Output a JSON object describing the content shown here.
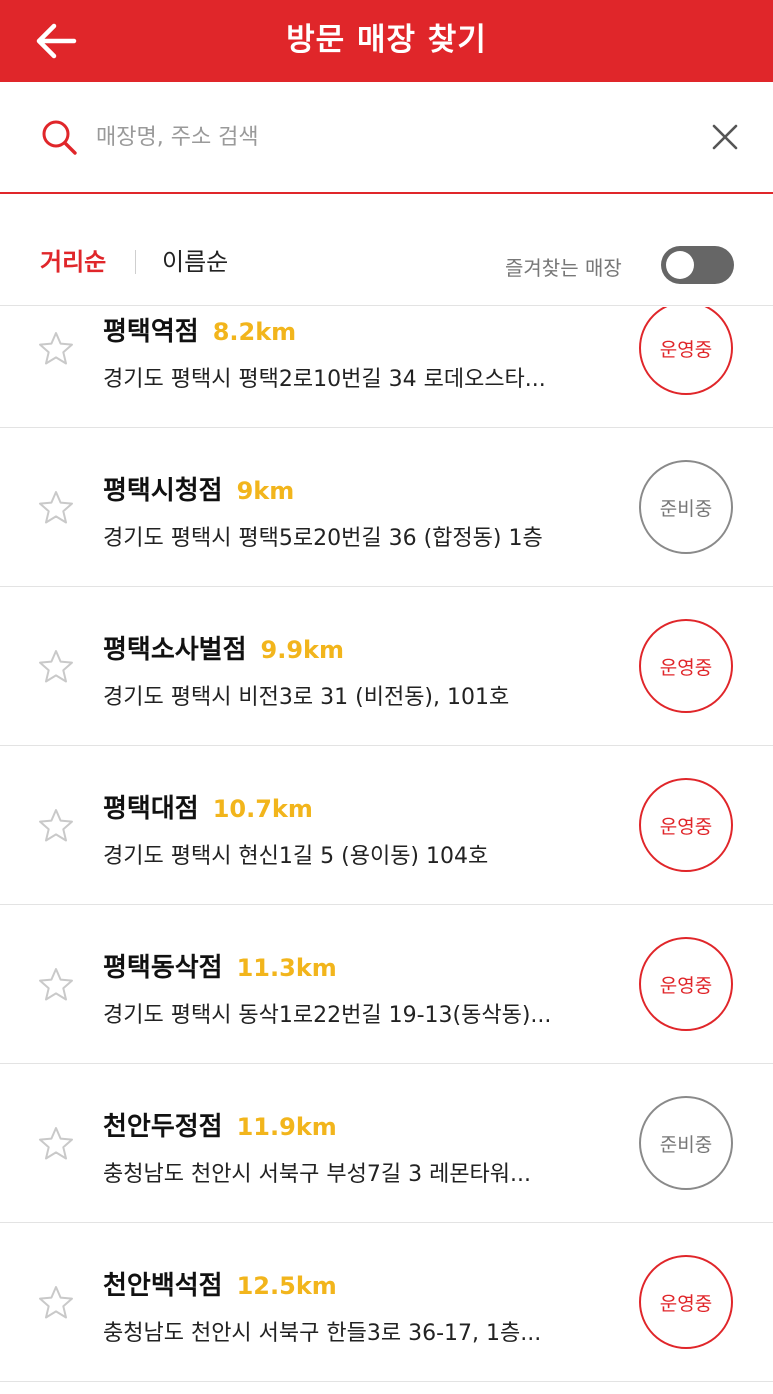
{
  "header": {
    "title": "방문 매장 찾기"
  },
  "search": {
    "placeholder": "매장명, 주소 검색",
    "value": ""
  },
  "sort": {
    "distance_label": "거리순",
    "name_label": "이름순",
    "active": "distance"
  },
  "favorites_filter": {
    "label": "즐겨찾는 매장",
    "on": false
  },
  "stores": [
    {
      "name": "평택역점",
      "distance": "8.2km",
      "address": "경기도 평택시 평택2로10번길 34 로데오스타...",
      "status": "운영중",
      "open": true,
      "favorite": false
    },
    {
      "name": "평택시청점",
      "distance": "9km",
      "address": "경기도 평택시 평택5로20번길 36 (합정동) 1층",
      "status": "준비중",
      "open": false,
      "favorite": false
    },
    {
      "name": "평택소사벌점",
      "distance": "9.9km",
      "address": "경기도 평택시 비전3로 31 (비전동), 101호",
      "status": "운영중",
      "open": true,
      "favorite": false
    },
    {
      "name": "평택대점",
      "distance": "10.7km",
      "address": "경기도 평택시 현신1길 5 (용이동) 104호",
      "status": "운영중",
      "open": true,
      "favorite": false
    },
    {
      "name": "평택동삭점",
      "distance": "11.3km",
      "address": "경기도 평택시 동삭1로22번길 19-13(동삭동)...",
      "status": "운영중",
      "open": true,
      "favorite": false
    },
    {
      "name": "천안두정점",
      "distance": "11.9km",
      "address": "충청남도 천안시 서북구 부성7길 3 레몬타워...",
      "status": "준비중",
      "open": false,
      "favorite": false
    },
    {
      "name": "천안백석점",
      "distance": "12.5km",
      "address": "충청남도 천안시 서북구 한들3로 36-17, 1층...",
      "status": "운영중",
      "open": true,
      "favorite": false
    }
  ],
  "colors": {
    "primary": "#e0262a",
    "distance": "#f2b51c",
    "closed": "#8a8a8a"
  },
  "icons": {
    "back": "arrow-left-icon",
    "search": "search-icon",
    "clear": "close-icon",
    "favorite": "star-outline-icon"
  }
}
